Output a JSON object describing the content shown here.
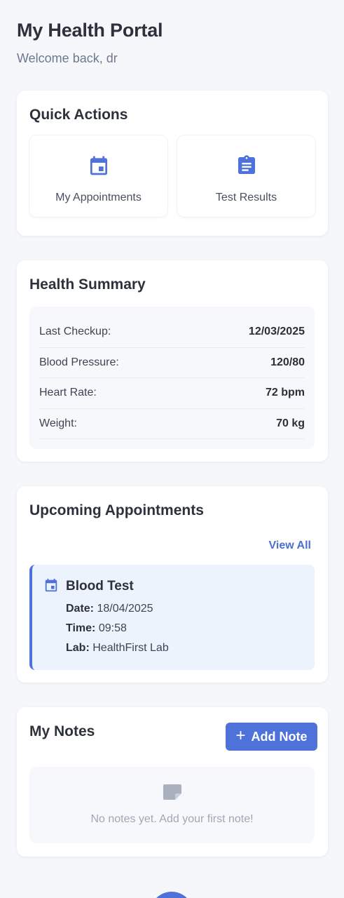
{
  "header": {
    "title": "My Health Portal",
    "subtitle": "Welcome back, dr"
  },
  "quick_actions": {
    "title": "Quick Actions",
    "items": [
      {
        "label": "My Appointments",
        "icon": "calendar-icon"
      },
      {
        "label": "Test Results",
        "icon": "clipboard-icon"
      }
    ]
  },
  "health_summary": {
    "title": "Health Summary",
    "rows": [
      {
        "label": "Last Checkup:",
        "value": "12/03/2025"
      },
      {
        "label": "Blood Pressure:",
        "value": "120/80"
      },
      {
        "label": "Heart Rate:",
        "value": "72 bpm"
      },
      {
        "label": "Weight:",
        "value": "70 kg"
      }
    ]
  },
  "upcoming": {
    "title": "Upcoming Appointments",
    "view_all": "View All",
    "appointment": {
      "title": "Blood Test",
      "date_label": "Date:",
      "date": "18/04/2025",
      "time_label": "Time:",
      "time": "09:58",
      "lab_label": "Lab:",
      "lab": "HealthFirst Lab"
    }
  },
  "notes": {
    "title": "My Notes",
    "add_label": "Add Note",
    "add_icon": "plus-icon",
    "empty_text": "No notes yet. Add your first note!",
    "empty_icon": "note-icon"
  },
  "colors": {
    "accent": "#4e71da",
    "background": "#f5f7fb",
    "appointment_bg": "#edf3fd"
  }
}
